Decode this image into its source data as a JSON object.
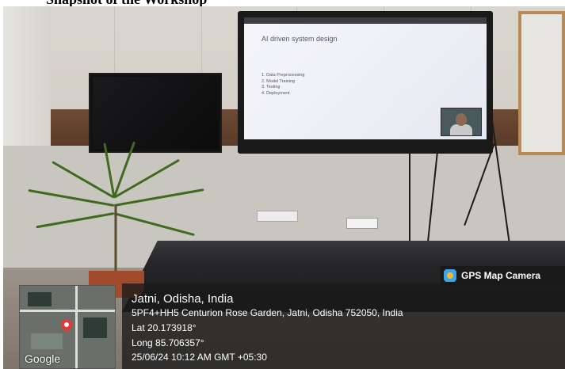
{
  "caption": "Snapshot of the Workshop",
  "presentation": {
    "slide_title": "AI driven system design",
    "agenda": [
      "Data Preprocessing",
      "Model Training",
      "Testing",
      "Deployment"
    ]
  },
  "gps_overlay": {
    "badge_label": "GPS Map Camera",
    "place": "Jatni, Odisha, India",
    "address": "5PF4+HH5 Centurion Rose Garden, Jatni, Odisha 752050, India",
    "latitude": "Lat 20.173918°",
    "longitude": "Long 85.706357°",
    "timestamp": "25/06/24 10:12 AM GMT +05:30",
    "map_brand": "Google"
  },
  "icons": {
    "camera_app": "gps-map-camera-icon",
    "map_pin": "location-pin-icon"
  },
  "colors": {
    "overlay_bg": "#191919",
    "overlay_text": "#ffffff",
    "pin": "#e53935"
  }
}
